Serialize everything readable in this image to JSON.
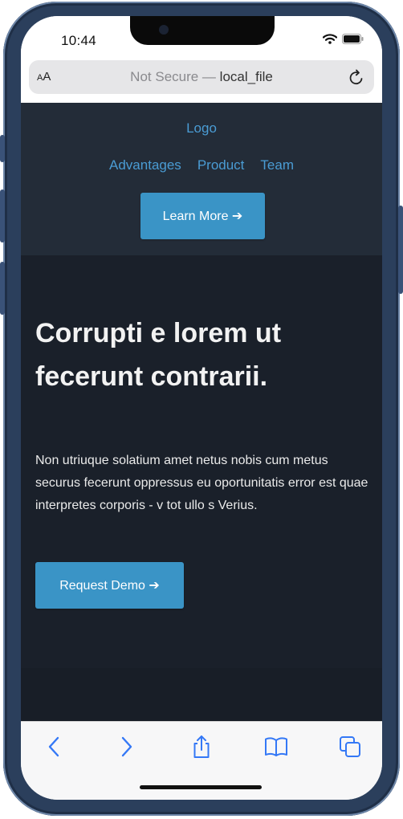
{
  "status_bar": {
    "time": "10:44"
  },
  "browser": {
    "aa_label_small": "A",
    "aa_label_large": "A",
    "url_prefix": "Not Secure — ",
    "url_host": "local_file"
  },
  "site": {
    "logo": "Logo",
    "nav": [
      "Advantages",
      "Product",
      "Team"
    ],
    "header_button": "Learn More ➔",
    "hero_title": "Corrupti e lorem ut fecerunt contrarii.",
    "hero_text": "Non utriuque solatium amet netus nobis cum metus securus fecerunt oppressus eu oportunitatis error est quae interpretes corporis - v tot ullo s Verius.",
    "cta_button": "Request Demo ➔"
  },
  "toolbar": {
    "icons": [
      "back-icon",
      "forward-icon",
      "share-icon",
      "bookmarks-icon",
      "tabs-icon"
    ]
  },
  "colors": {
    "header_bg": "#232c38",
    "page_bg": "#1a202a",
    "accent": "#3a94c6",
    "link": "#4a9cd4",
    "ios_blue": "#3478f6"
  }
}
